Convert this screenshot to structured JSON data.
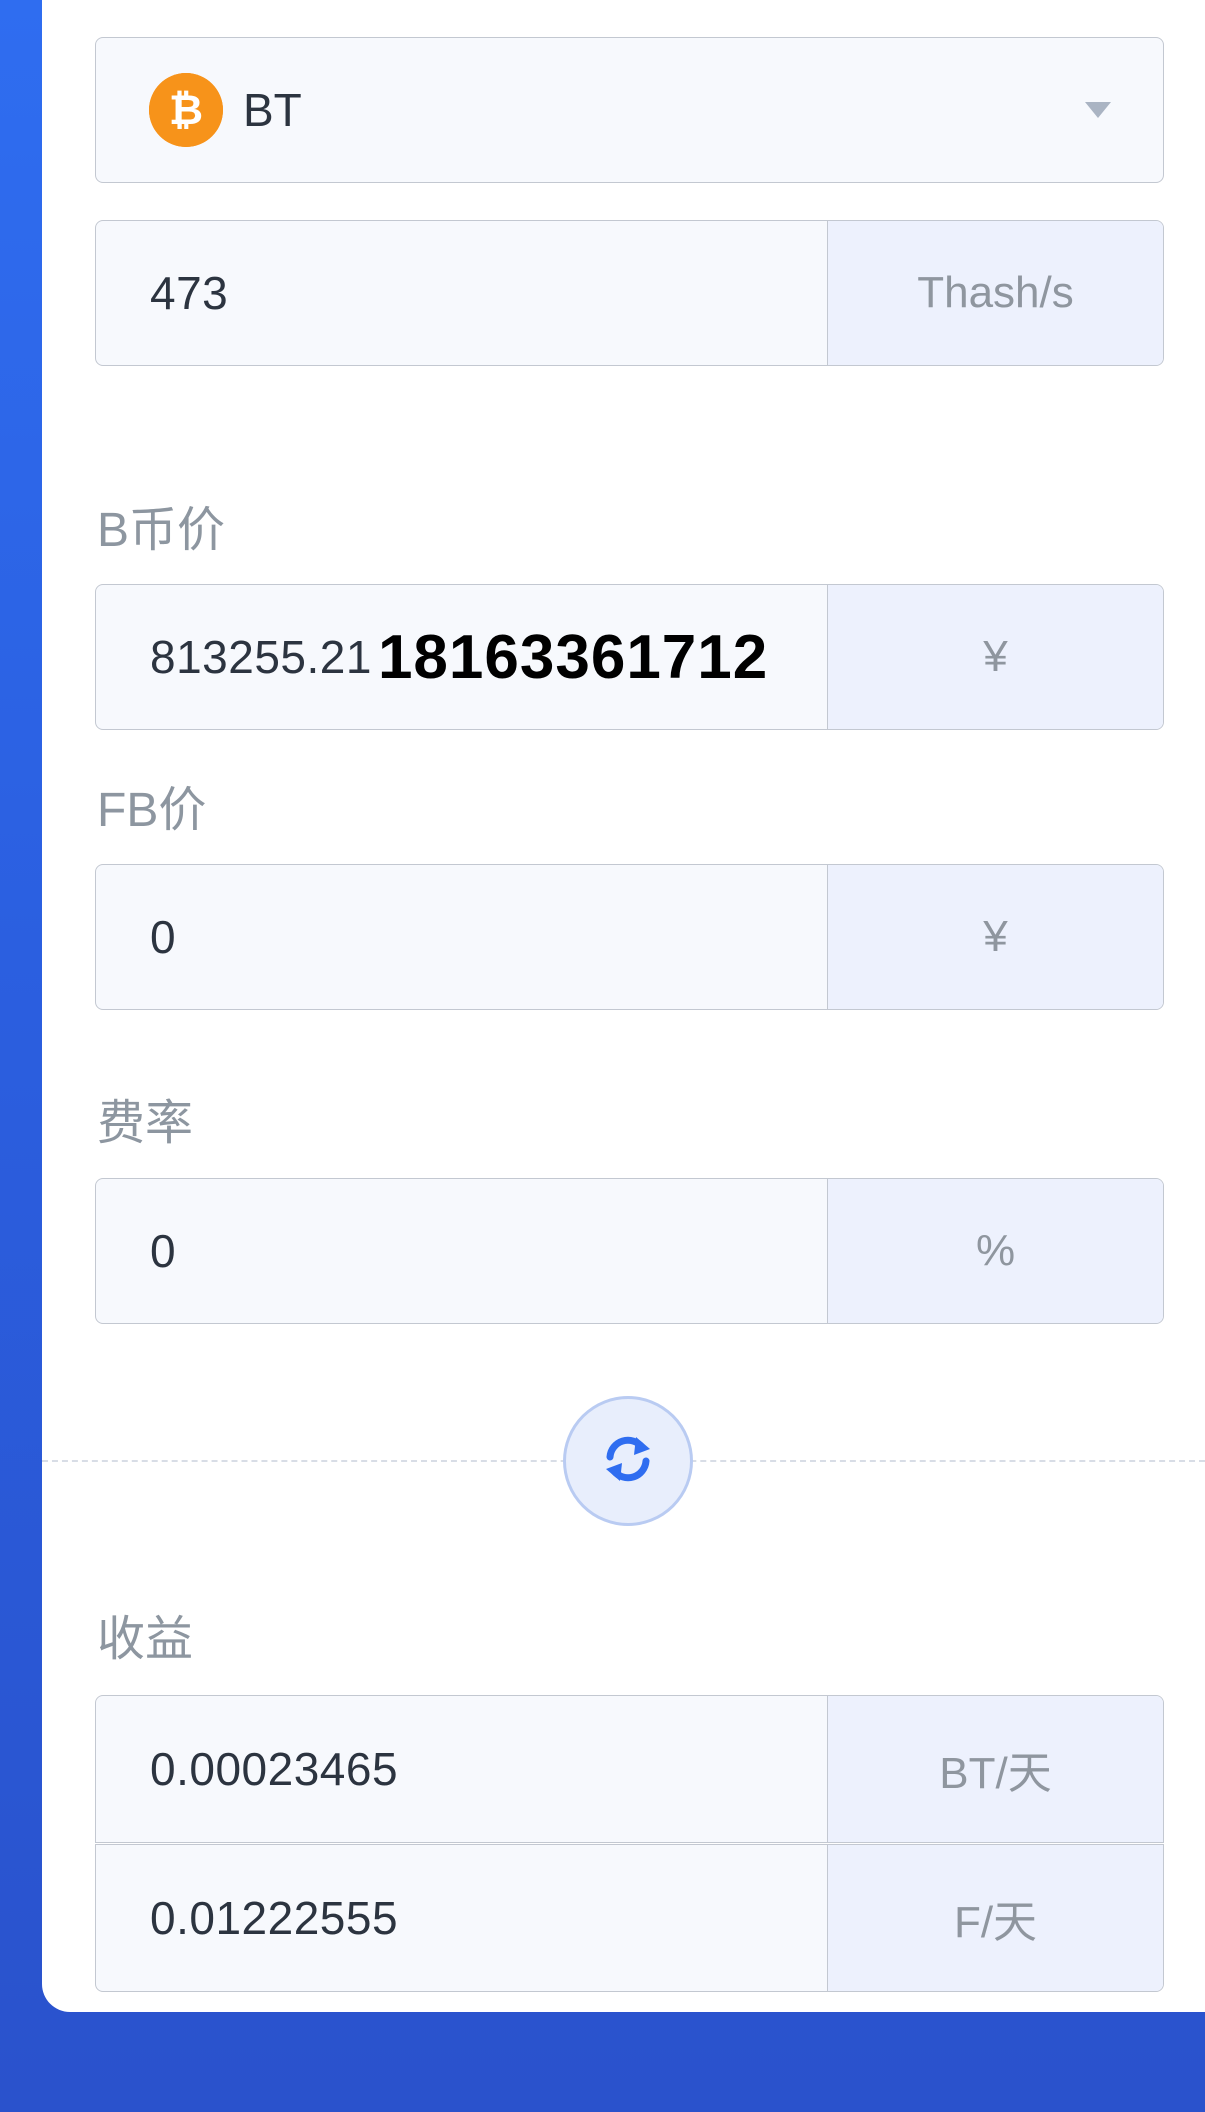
{
  "coin": {
    "name": "BT",
    "logo_symbol": "₿",
    "logo_icon": "bitcoin-icon",
    "dropdown_icon": "caret-down-icon"
  },
  "hashrate": {
    "value": "473",
    "unit": "Thash/s"
  },
  "coin_price": {
    "label": "B币价",
    "value": "813255.21",
    "overlay": "18163361712",
    "unit": "¥"
  },
  "fb_price": {
    "label": "FB价",
    "value": "0",
    "unit": "¥"
  },
  "fee": {
    "label": "费率",
    "value": "0",
    "unit": "%"
  },
  "swap": {
    "icon": "swap-icon"
  },
  "earnings": {
    "label": "收益",
    "rows": [
      {
        "value": "0.00023465",
        "unit": "BT/天"
      },
      {
        "value": "0.01222555",
        "unit": "F/天"
      }
    ]
  },
  "colors": {
    "accent": "#2f6df0",
    "coin_orange": "#f7931a"
  }
}
